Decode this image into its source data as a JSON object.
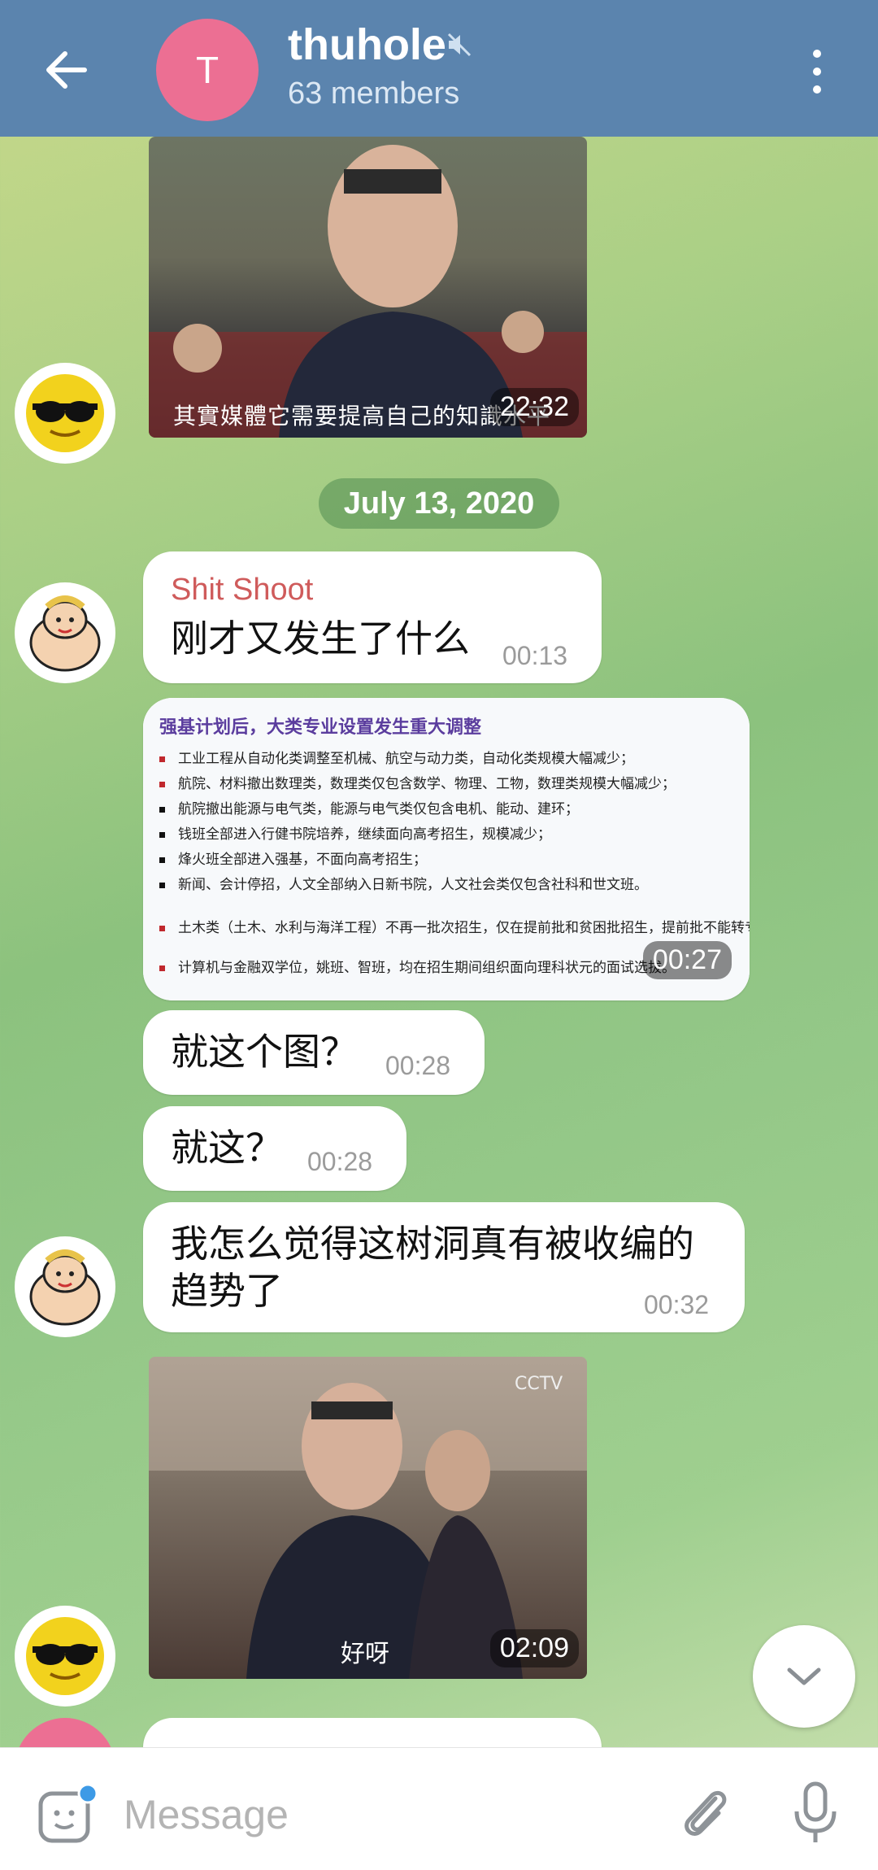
{
  "header": {
    "avatar_letter": "T",
    "title": "thuhole",
    "members": "63 members"
  },
  "chat": {
    "first_video": {
      "subtitle": "其實媒體它需要提高自己的知識水平",
      "duration": "22:32"
    },
    "date_separator": "July 13, 2020",
    "message1": {
      "sender": "Shit Shoot",
      "text": "刚才又发生了什么",
      "time": "00:13"
    },
    "image_message": {
      "title": "强基计划后，大类专业设置发生重大调整",
      "lines": [
        "工业工程从自动化类调整至机械、航空与动力类，自动化类规模大幅减少；",
        "航院、材料撤出数理类，数理类仅包含数学、物理、工物，数理类规模大幅减少；",
        "航院撤出能源与电气类，能源与电气类仅包含电机、能动、建环；",
        "钱班全部进入行健书院培养，继续面向高考招生，规模减少；",
        "烽火班全部进入强基，不面向高考招生；",
        "新闻、会计停招，人文全部纳入日新书院，人文社会类仅包含社科和世文班。",
        "土木类（土木、水利与海洋工程）不再一批次招生，仅在提前批和贫困批招生，提前批不能转专业；",
        "计算机与金融双学位，姚班、智班，均在招生期间组织面向理科状元的面试选拔。"
      ],
      "time": "00:27"
    },
    "message3": {
      "text": "就这个图？",
      "time": "00:28"
    },
    "message4": {
      "text": "就这？",
      "time": "00:28"
    },
    "message5": {
      "text_line1": "我怎么觉得这树洞真有被收编的",
      "text_line2": "趋势了",
      "time": "00:32"
    },
    "second_video": {
      "subtitle": "好呀",
      "duration": "02:09"
    }
  },
  "input": {
    "placeholder": "Message"
  },
  "colors": {
    "header": "#5b84ae",
    "sender": "#cf5b5b",
    "avatar": "#ec6f93"
  }
}
